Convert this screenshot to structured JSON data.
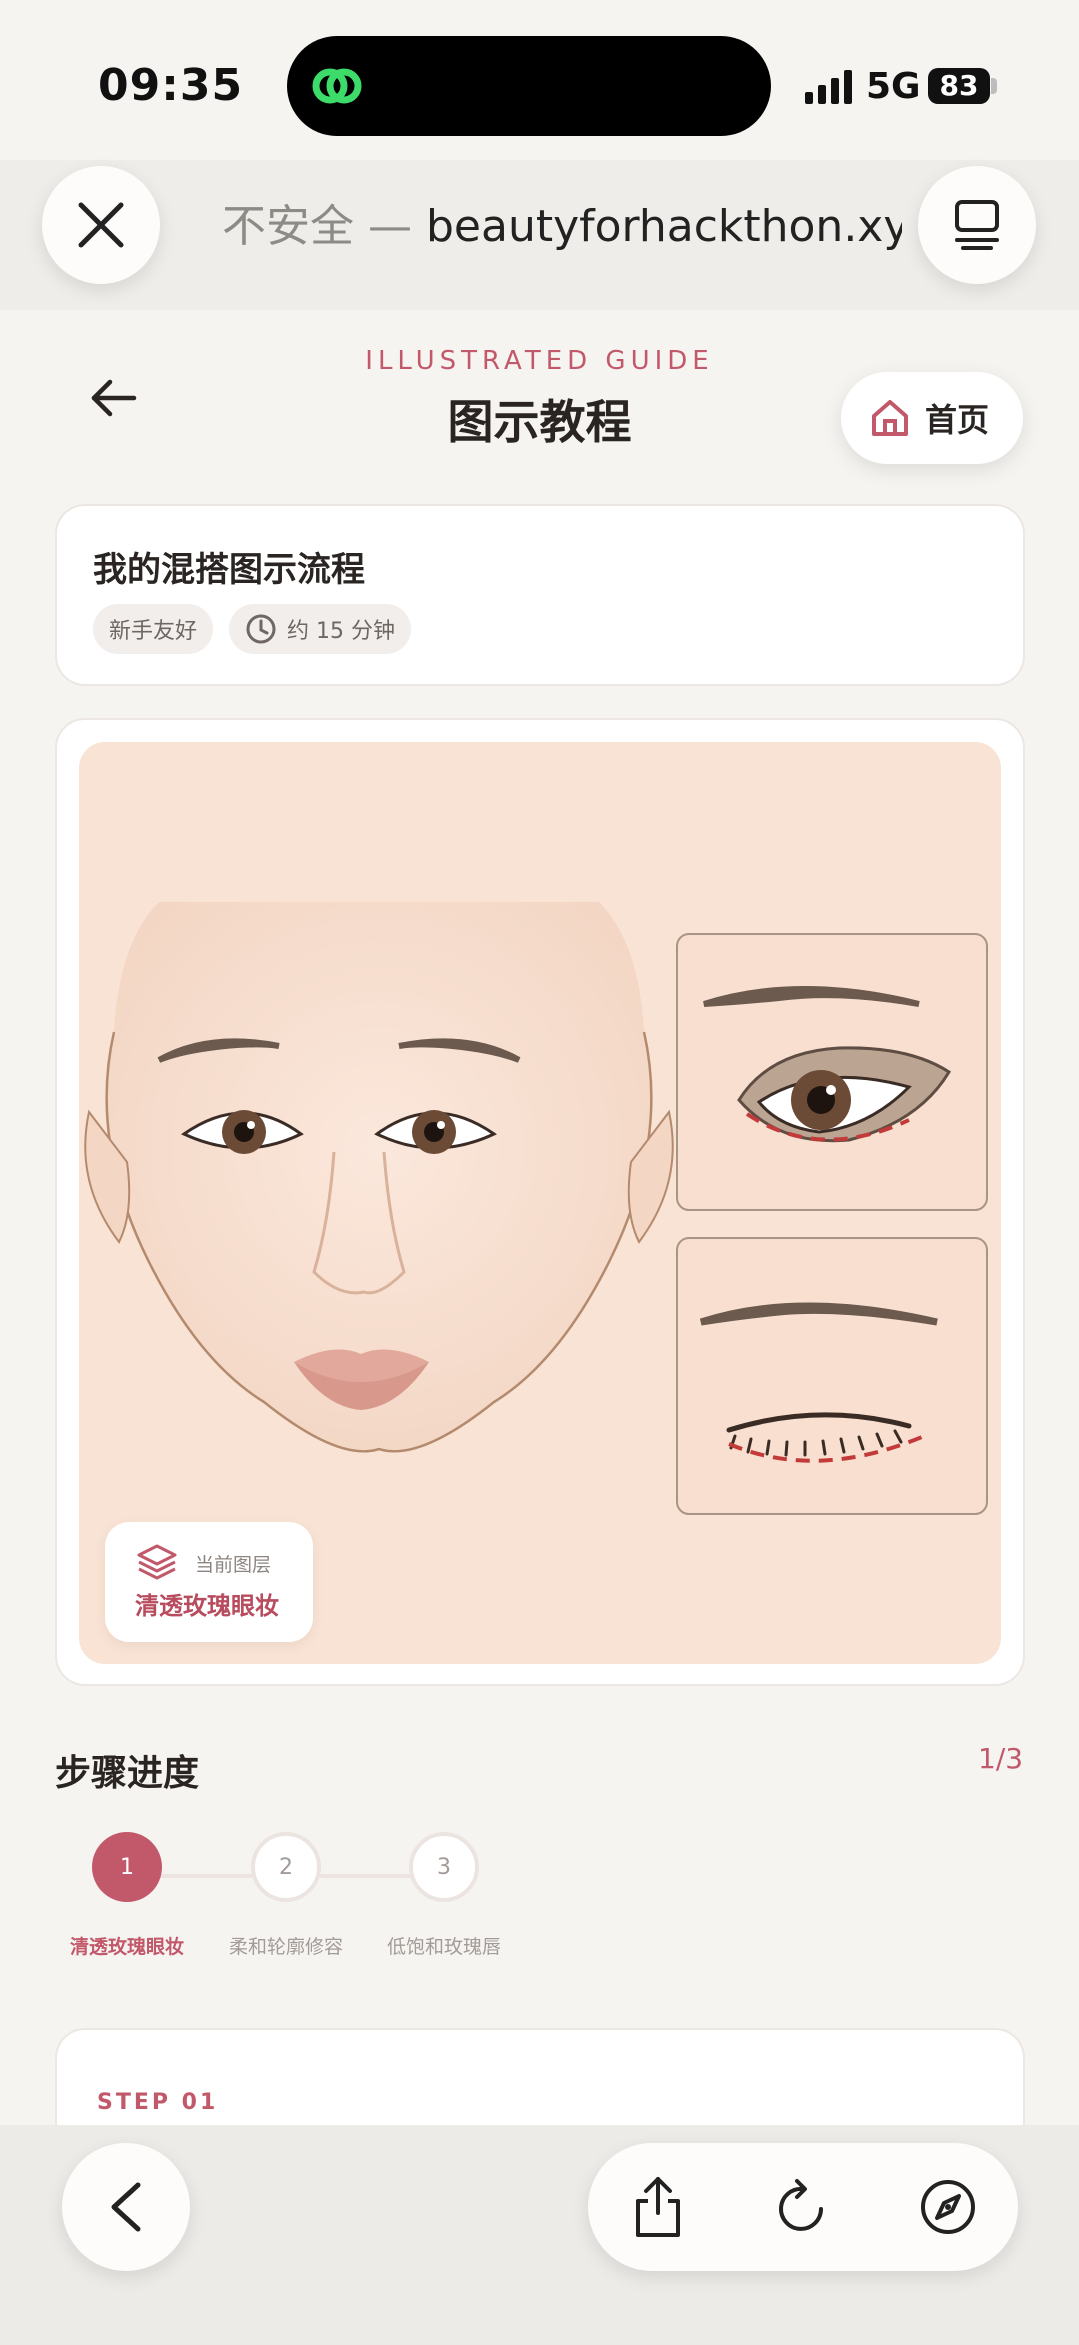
{
  "status_bar": {
    "time": "09:35",
    "network": "5G",
    "battery": "83",
    "icons": [
      "app-logo-icon",
      "signal-icon",
      "battery-icon"
    ]
  },
  "browser": {
    "url_insecure": "不安全 — ",
    "url_domain": "beautyforhackthon.xyz",
    "close_icon": "close-icon",
    "tabs_icon": "tabs-icon"
  },
  "header": {
    "eyebrow": "ILLUSTRATED GUIDE",
    "title": "图示教程",
    "home_label": "首页",
    "back_icon": "back-arrow-icon",
    "home_icon": "home-icon"
  },
  "info_card": {
    "title": "我的混搭图示流程",
    "tags": [
      "新手友好",
      "约 15 分钟"
    ],
    "time_icon": "clock-icon"
  },
  "illustration": {
    "current_layer_label": "当前图层",
    "current_layer_name": "清透玫瑰眼妆",
    "layer_icon": "layers-icon",
    "accent_color": "#c2596a"
  },
  "progress": {
    "title": "步骤进度",
    "count": "1/3",
    "steps": [
      {
        "number": "1",
        "label": "清透玫瑰眼妆",
        "active": true
      },
      {
        "number": "2",
        "label": "柔和轮廓修容",
        "active": false
      },
      {
        "number": "3",
        "label": "低饱和玫瑰唇",
        "active": false
      }
    ]
  },
  "step_card": {
    "kicker": "STEP 01"
  },
  "toolbar": {
    "icons": [
      "back-icon",
      "share-icon",
      "reload-icon",
      "compass-icon"
    ]
  }
}
